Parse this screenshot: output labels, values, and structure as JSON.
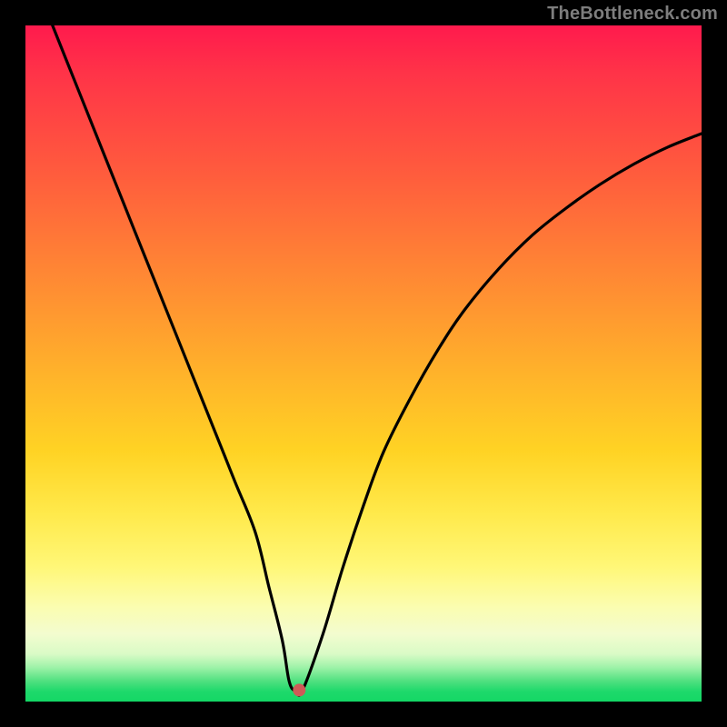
{
  "watermark": "TheBottleneck.com",
  "chart_data": {
    "type": "line",
    "title": "",
    "xlabel": "",
    "ylabel": "",
    "xlim": [
      0,
      100
    ],
    "ylim": [
      0,
      100
    ],
    "note": "No axis ticks or numeric labels are rendered; values below are estimated from pixel positions on a 0–100 normalized domain.",
    "series": [
      {
        "name": "curve",
        "x": [
          4,
          7,
          10,
          13,
          16,
          19,
          22,
          25,
          28,
          31,
          34,
          36,
          38,
          39,
          40,
          41,
          44,
          47,
          50,
          53,
          57,
          61,
          65,
          70,
          75,
          80,
          85,
          90,
          95,
          100
        ],
        "y": [
          100,
          92.5,
          85,
          77.5,
          70,
          62.5,
          55,
          47.5,
          40,
          32.5,
          25,
          17,
          9,
          3,
          1.5,
          1.7,
          10,
          20,
          29,
          37,
          45,
          52,
          58,
          64,
          69,
          73,
          76.5,
          79.5,
          82,
          84
        ]
      }
    ],
    "marker": {
      "x": 40.5,
      "y": 1.7,
      "color": "#cf5a57",
      "radius_px": 7
    },
    "colors": {
      "curve": "#000000",
      "background_top": "#ff1a4d",
      "background_mid": "#ffd324",
      "background_bottom": "#14d765",
      "frame": "#000000",
      "watermark": "#7d7d7d"
    }
  }
}
